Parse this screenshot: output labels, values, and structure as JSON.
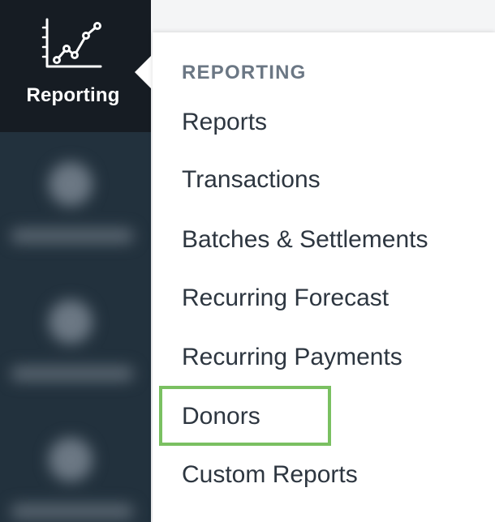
{
  "sidebar": {
    "active_item": {
      "label": "Reporting",
      "icon": "line-chart-icon"
    }
  },
  "menu": {
    "heading": "REPORTING",
    "items": [
      {
        "label": "Reports"
      },
      {
        "label": "Transactions"
      },
      {
        "label": "Batches & Settlements"
      },
      {
        "label": "Recurring Forecast"
      },
      {
        "label": "Recurring Payments"
      },
      {
        "label": "Donors",
        "highlighted": true
      },
      {
        "label": "Custom Reports"
      }
    ]
  },
  "colors": {
    "sidebar_bg": "#22313d",
    "active_bg": "#161c23",
    "highlight_border": "#7ac061",
    "heading_text": "#6b7784",
    "item_text": "#2d3640"
  }
}
